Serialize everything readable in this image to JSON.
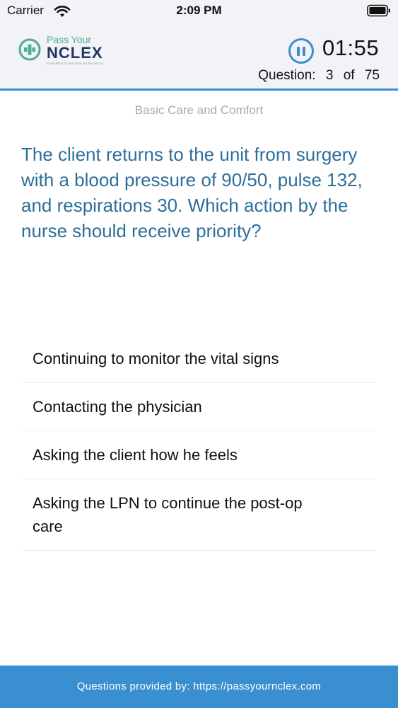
{
  "status_bar": {
    "carrier": "Carrier",
    "time": "2:09 PM"
  },
  "header": {
    "logo_text_top": "Pass Your",
    "logo_text_main": "NCLEX",
    "logo_tagline": "YOUR PATH TO SUCCESS ON THE NCLEX",
    "timer": "01:55",
    "question_label": "Question:",
    "question_current": "3",
    "question_of": "of",
    "question_total": "75"
  },
  "category": "Basic Care and Comfort",
  "question": "The client returns to the unit from surgery with a blood pressure of 90/50, pulse 132, and respirations 30. Which action by the nurse should receive priority?",
  "answers": [
    "Continuing to monitor the vital signs",
    "Contacting the physician",
    "Asking the client how he feels",
    "Asking the LPN to continue the post-op care"
  ],
  "footer": "Questions provided by: https://passyournclex.com",
  "colors": {
    "accent": "#3a8fd0",
    "question": "#2d6f9a",
    "logo_green": "#4cae8c",
    "logo_navy": "#1f3564"
  }
}
